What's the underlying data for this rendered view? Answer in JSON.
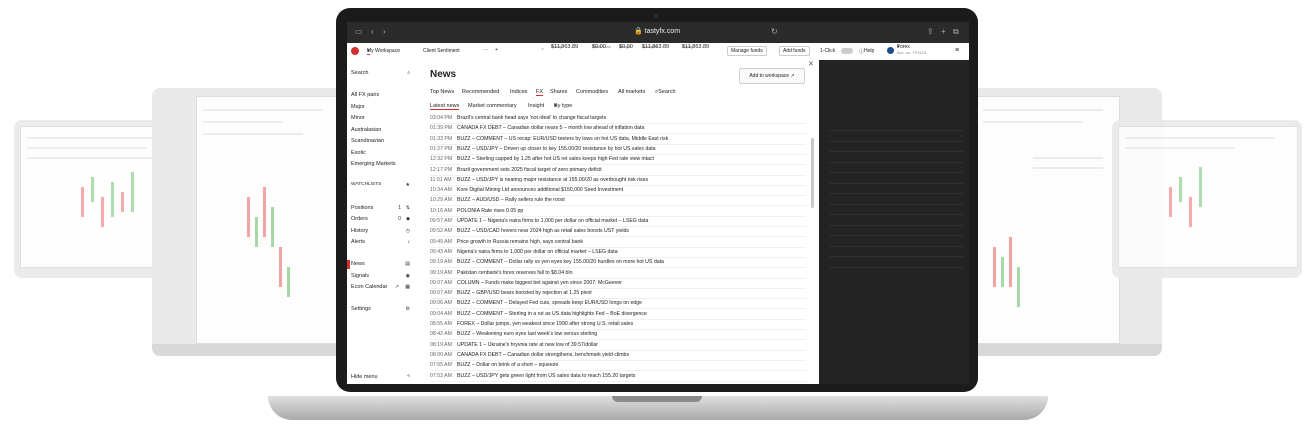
{
  "browser": {
    "url": "tastyfx.com"
  },
  "topbar": {
    "workspace": "My Workspace",
    "client_sentiment": "Client Sentiment",
    "more": "···",
    "add": "+",
    "accounts": [
      {
        "label": "Funds",
        "value": "$11,863.89"
      },
      {
        "label": "Profit/Loss",
        "value": "$0.00"
      },
      {
        "label": "Margin",
        "value": "$0.00"
      },
      {
        "label": "Available",
        "value": "$11,863.89"
      },
      {
        "label": "Equity",
        "value": "$11,863.89"
      }
    ],
    "manage_funds": "Manage funds",
    "add_funds": "Add funds",
    "one_click": "1-Click",
    "help": "Help",
    "account_name": "Forex",
    "account_no": "Acc. no. TF4123"
  },
  "sidebar": {
    "search": "Search",
    "markets": [
      "All FX pairs",
      "Major",
      "Minor",
      "Australasian",
      "Scandinavian",
      "Exotic",
      "Emerging Markets"
    ],
    "watchlists": "WATCHLISTS",
    "account_items": [
      {
        "label": "Positions",
        "badge": "1"
      },
      {
        "label": "Orders",
        "badge": "0"
      },
      {
        "label": "History",
        "badge": ""
      },
      {
        "label": "Alerts",
        "badge": ""
      }
    ],
    "tools": [
      "News",
      "Signals",
      "Econ Calendar"
    ],
    "settings": "Settings",
    "hide_menu": "Hide menu"
  },
  "content": {
    "title": "News",
    "add_to_workspace": "Add to workspace",
    "tabs": [
      "Top News",
      "Recommended",
      "Indices",
      "FX",
      "Shares",
      "Commodities",
      "All markets",
      "Search"
    ],
    "active_tab": "FX",
    "subtabs": [
      "Latest news",
      "Market commentary",
      "Insight",
      "By type"
    ],
    "news": [
      {
        "time": "03:04 PM",
        "text": "Brazil's central bank head says 'not ideal' to change fiscal targets"
      },
      {
        "time": "01:39 PM",
        "text": "CANADA FX DEBT – Canadian dollar nears 5 – month low ahead of inflation data"
      },
      {
        "time": "01:33 PM",
        "text": "BUZZ – COMMENT – US recap: EUR/USD teeters by lows on hot US data, Middle East risk"
      },
      {
        "time": "01:27 PM",
        "text": "BUZZ – USD/JPY – Driven up closer to key 155.00/20 resistance by hot US sales data"
      },
      {
        "time": "12:32 PM",
        "text": "BUZZ – Sterling capped by 1.25 after hot US ret sales keeps high Fed rate view intact"
      },
      {
        "time": "12:17 PM",
        "text": "Brazil government sets 2025 fiscal target of zero primary deficit"
      },
      {
        "time": "11:01 AM",
        "text": "BUZZ – USD/JPY is nearing major resistance at 155.00/20 as overbought risk rises"
      },
      {
        "time": "10:34 AM",
        "text": "Kore Digital Mining Ltd announces additional $150,000 Seed Investment"
      },
      {
        "time": "10:29 AM",
        "text": "BUZZ – AUD/USD – Rally sellers rule the roost"
      },
      {
        "time": "10:16 AM",
        "text": "POLONIA Rate rises 0.05 pp"
      },
      {
        "time": "09:57 AM",
        "text": "UPDATE 1 – Nigeria's naira firms to 1,000 per dollar on official market – LSEG data"
      },
      {
        "time": "09:52 AM",
        "text": "BUZZ – USD/CAD hovers near 2024 high as retail sales boosts UST yields"
      },
      {
        "time": "09:49 AM",
        "text": "Price growth in Russia remains high, says central bank"
      },
      {
        "time": "09:43 AM",
        "text": "Nigeria's naira firms to 1,000 per dollar on official market – LSEG data"
      },
      {
        "time": "09:19 AM",
        "text": "BUZZ – COMMENT – Dollar rally vs yen eyes key 155.00/20 hurdles on more hot US data"
      },
      {
        "time": "09:19 AM",
        "text": "Pakistan cenbank's forex reserves fall to $8.04 bln"
      },
      {
        "time": "09:07 AM",
        "text": "COLUMN – Funds make biggest bet against yen since 2007: McGeever"
      },
      {
        "time": "09:07 AM",
        "text": "BUZZ – GBP/USD bears boosted by rejection at 1.25 pivot"
      },
      {
        "time": "09:06 AM",
        "text": "BUZZ – COMMENT – Delayed Fed cuts, spreads keep EUR/USD longs on edge"
      },
      {
        "time": "09:04 AM",
        "text": "BUZZ – COMMENT – Sterling in a rut as US data highlights Fed – BoE divergence"
      },
      {
        "time": "08:55 AM",
        "text": "FOREX – Dollar jumps, yen weakest since 1990 after strong U.S. retail sales"
      },
      {
        "time": "08:42 AM",
        "text": "BUZZ – Weakening euro eyes last week's low versus sterling"
      },
      {
        "time": "08:19 AM",
        "text": "UPDATE 1 – Ukraine's hryvnia rate at new low of 39.57/dollar"
      },
      {
        "time": "08:00 AM",
        "text": "CANADA FX DEBT – Canadian dollar strengthens, benchmark yield climbs"
      },
      {
        "time": "07:55 AM",
        "text": "BUZZ – Dollar on brink of a short – squeeze"
      },
      {
        "time": "07:53 AM",
        "text": "BUZZ – USD/JPY gets green light from US sales data to reach 155.20 targets"
      }
    ]
  },
  "colors": {
    "accent": "#d32f2f",
    "dark_panel": "#232323",
    "bezel": "#1b1b1b"
  }
}
